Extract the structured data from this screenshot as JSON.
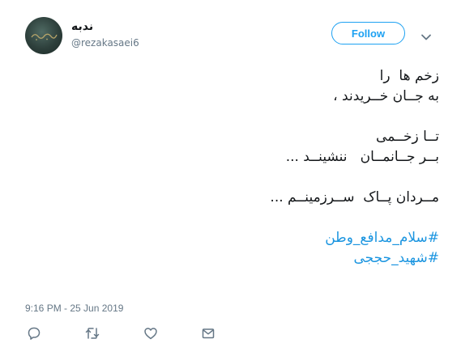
{
  "tweet": {
    "display_name": "ندبه",
    "handle": "@rezakasaei6",
    "follow_label": "Follow",
    "lines": [
      "زخم ها  را",
      "به جــان خــریدند ،",
      "",
      "تــا زخــمی",
      "بــر جــانمــان   ننشینــد ...",
      "",
      "مــردان پــاک  ســرزمینــم ..."
    ],
    "spacer": "",
    "hashtags": [
      "#سلام_مدافع_وطن",
      "#شهید_حججی"
    ],
    "timestamp": "9:16 PM - 25 Jun 2019"
  },
  "icons": {
    "reply": "reply-icon",
    "retweet": "retweet-icon",
    "like": "heart-icon",
    "dm": "envelope-icon",
    "caret": "chevron-down-icon"
  },
  "colors": {
    "accent": "#1da1f2",
    "hashtag": "#1b95e0",
    "muted": "#657786",
    "text": "#14171a"
  }
}
